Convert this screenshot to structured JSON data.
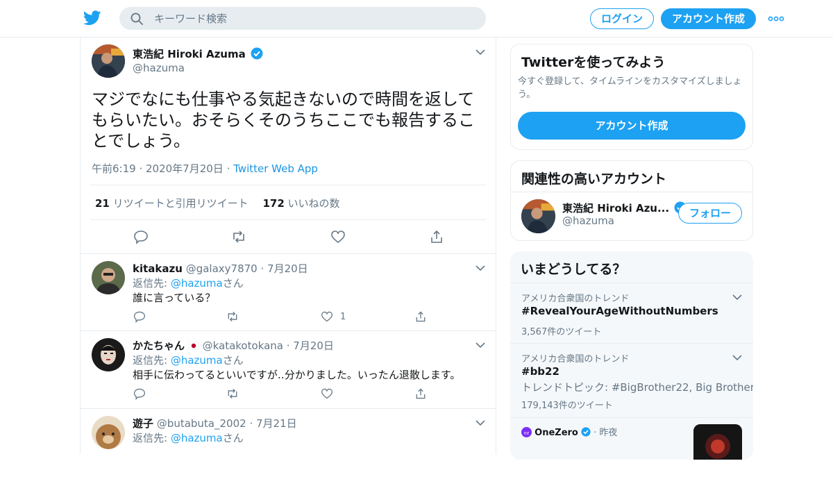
{
  "header": {
    "search_placeholder": "キーワード検索",
    "login_label": "ログイン",
    "signup_label": "アカウント作成"
  },
  "tweet": {
    "display_name": "東浩紀 Hiroki Azuma",
    "handle": "@hazuma",
    "text": "マジでなにも仕事やる気起きないので時間を返してもらいたい。おそらくそのうちここでも報告することでしょう。",
    "time": "午前6:19",
    "date": "2020年7月20日",
    "source": "Twitter Web App",
    "retweets": "21",
    "retweets_label": "リツイートと引用リツイート",
    "likes": "172",
    "likes_label": "いいねの数"
  },
  "replies": [
    {
      "name": "kitakazu",
      "handle": "@galaxy7870",
      "date": "7月20日",
      "reply_prefix": "返信先: ",
      "reply_to": "@hazuma",
      "reply_suffix": "さん",
      "text": "誰に言っている？",
      "like_count": "1"
    },
    {
      "name": "かたちゃん",
      "handle": "@katakotokana",
      "date": "7月20日",
      "reply_prefix": "返信先: ",
      "reply_to": "@hazuma",
      "reply_suffix": "さん",
      "text": "相手に伝わってるといいですが‥分かりました。いったん退散します。",
      "like_count": ""
    },
    {
      "name": "遊子",
      "handle": "@butabuta_2002",
      "date": "7月21日",
      "reply_prefix": "返信先: ",
      "reply_to": "@hazuma",
      "reply_suffix": "さん",
      "text": "",
      "like_count": ""
    }
  ],
  "sidebar": {
    "signup_card": {
      "title": "Twitterを使ってみよう",
      "description": "今すぐ登録して、タイムラインをカスタマイズしましょう。",
      "button": "アカウント作成"
    },
    "related": {
      "title": "関連性の高いアカウント",
      "name": "東浩紀 Hiroki Azu...",
      "handle": "@hazuma",
      "follow": "フォロー"
    },
    "trends": {
      "title": "いまどうしてる？",
      "items": [
        {
          "context": "アメリカ合衆国のトレンド",
          "name": "#RevealYourAgeWithoutNumbers",
          "description": "",
          "count": "3,567件のツイート"
        },
        {
          "context": "アメリカ合衆国のトレンド",
          "name": "#bb22",
          "description": "トレンドトピック: #BigBrother22, Big Brother",
          "count": "179,143件のツイート"
        }
      ],
      "news_source": "OneZero",
      "news_time": "昨夜"
    }
  },
  "colors": {
    "accent": "#1da1f2",
    "text": "#14171a",
    "secondary": "#657786",
    "border": "#e6ecf0"
  }
}
